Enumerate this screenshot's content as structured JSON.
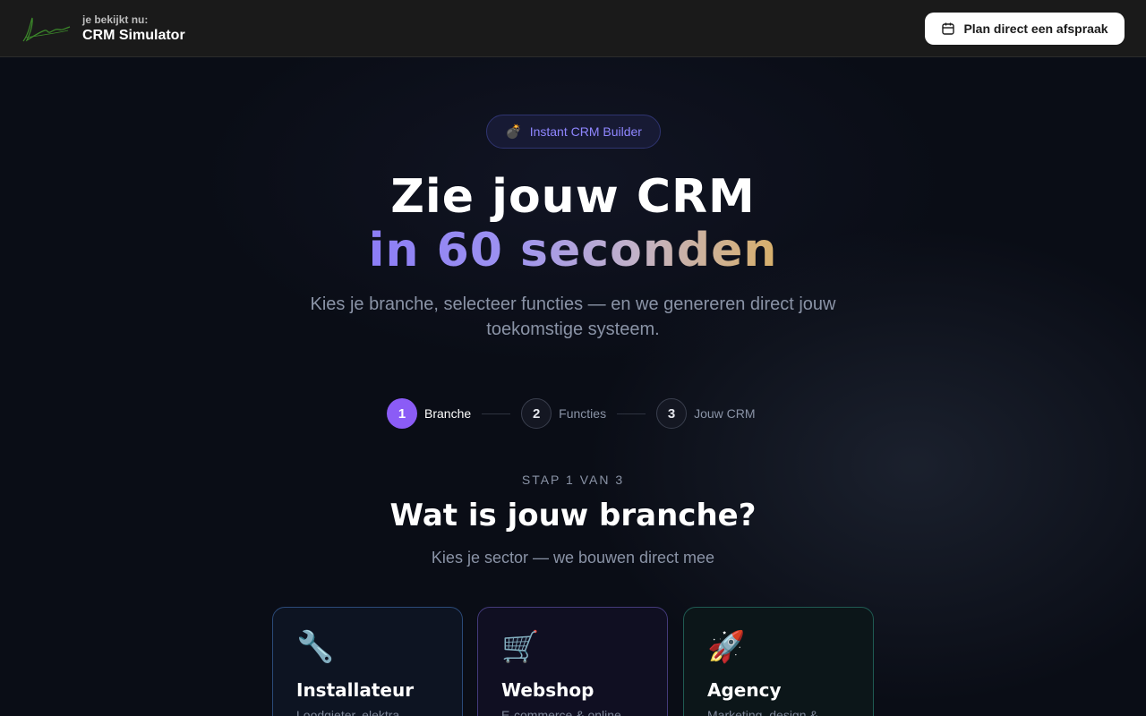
{
  "header": {
    "viewing_label": "je bekijkt nu:",
    "viewing_title": "CRM Simulator",
    "cta_label": "Plan direct een afspraak"
  },
  "badge": {
    "emoji": "💣",
    "label": "Instant CRM Builder"
  },
  "hero": {
    "line1": "Zie jouw CRM",
    "line2": "in 60 seconden",
    "subtitle": "Kies je branche, selecteer functies — en we genereren direct jouw toekomstige systeem."
  },
  "stepper": {
    "steps": [
      {
        "number": "1",
        "label": "Branche",
        "active": true
      },
      {
        "number": "2",
        "label": "Functies",
        "active": false
      },
      {
        "number": "3",
        "label": "Jouw CRM",
        "active": false
      }
    ]
  },
  "step_header": {
    "count": "STAP 1 VAN 3",
    "title": "Wat is jouw branche?",
    "subtitle": "Kies je sector — we bouwen direct mee"
  },
  "cards": [
    {
      "emoji": "🔧",
      "title": "Installateur",
      "description": "Loodgieter, elektra..."
    },
    {
      "emoji": "🛒",
      "title": "Webshop",
      "description": "E-commerce & online..."
    },
    {
      "emoji": "🚀",
      "title": "Agency",
      "description": "Marketing, design &..."
    }
  ],
  "colors": {
    "accent": "#8b5cf6",
    "badge_text": "#8f86ff",
    "gradient": [
      "#8c7df6",
      "#c2b2c9",
      "#d8b06a"
    ]
  }
}
